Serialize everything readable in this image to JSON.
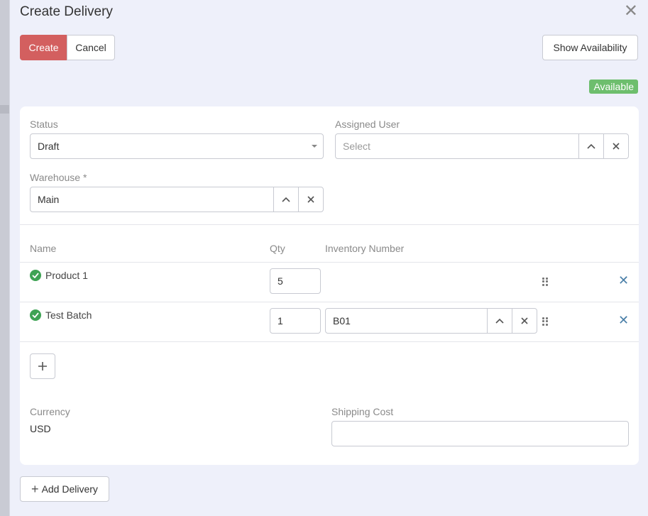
{
  "modal": {
    "title": "Create Delivery",
    "close_icon": "close-icon"
  },
  "toolbar": {
    "create_label": "Create",
    "cancel_label": "Cancel",
    "show_availability_label": "Show Availability",
    "create_color": "#d35f5f"
  },
  "availability_badge": {
    "text": "Available",
    "color": "#6dbe6d"
  },
  "form": {
    "status": {
      "label": "Status",
      "value": "Draft"
    },
    "assigned_user": {
      "label": "Assigned User",
      "placeholder": "Select"
    },
    "warehouse": {
      "label": "Warehouse *",
      "value": "Main"
    }
  },
  "items_table": {
    "headers": {
      "name": "Name",
      "qty": "Qty",
      "inventory_number": "Inventory Number"
    },
    "rows": [
      {
        "name": "Product 1",
        "qty": "5",
        "inventory_number": ""
      },
      {
        "name": "Test Batch",
        "qty": "1",
        "inventory_number": "B01"
      }
    ],
    "check_color": "#3ea354"
  },
  "footer": {
    "currency": {
      "label": "Currency",
      "value": "USD"
    },
    "shipping_cost": {
      "label": "Shipping Cost",
      "value": ""
    }
  },
  "add_delivery_label": "Add Delivery"
}
